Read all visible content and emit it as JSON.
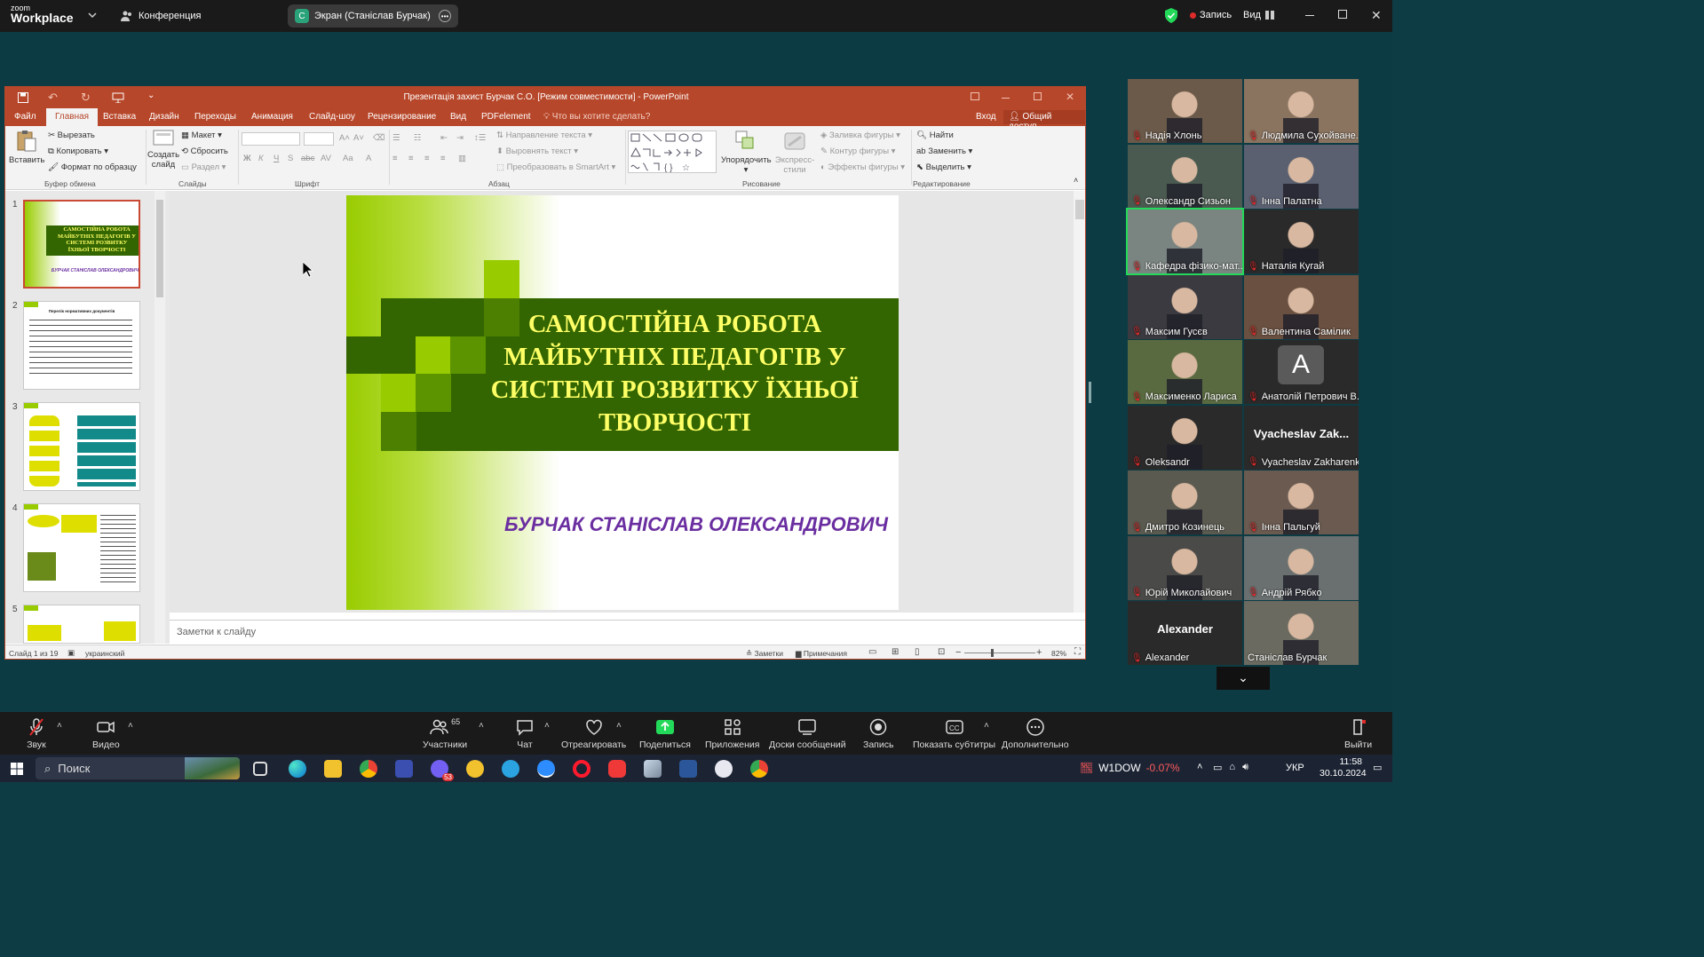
{
  "zoom": {
    "logo_top": "zoom",
    "logo_bottom": "Workplace",
    "meeting_label": "Конференция",
    "share_label": "Экран (Станіслав Бурчак)",
    "share_initial": "C",
    "record_label": "Запись",
    "view_label": "Вид"
  },
  "ppt": {
    "title": "Презентація захист Бурчак С.О. [Режим совместимости] - PowerPoint",
    "tabs": [
      "Файл",
      "Главная",
      "Вставка",
      "Дизайн",
      "Переходы",
      "Анимация",
      "Слайд-шоу",
      "Рецензирование",
      "Вид",
      "PDFelement"
    ],
    "tell_me": "Что вы хотите сделать?",
    "signin": "Вход",
    "share": "Общий доступ",
    "ribbon": {
      "paste": "Вставить",
      "cut": "Вырезать",
      "copy": "Копировать",
      "format_painter": "Формат по образцу",
      "clipboard": "Буфер обмена",
      "new_slide_1": "Создать",
      "new_slide_2": "слайд",
      "layout": "Макет",
      "reset": "Сбросить",
      "section": "Раздел",
      "slides": "Слайды",
      "font": "Шрифт",
      "text_direction": "Направление текста",
      "align_text": "Выровнять текст",
      "smartart": "Преобразовать в SmartArt",
      "paragraph": "Абзац",
      "arrange": "Упорядочить",
      "quick_styles_1": "Экспресс-",
      "quick_styles_2": "стили",
      "shape_fill": "Заливка фигуры",
      "shape_outline": "Контур фигуры",
      "shape_effects": "Эффекты фигуры",
      "drawing": "Рисование",
      "find": "Найти",
      "replace": "Заменить",
      "select": "Выделить",
      "editing": "Редактирование"
    },
    "thumb_numbers": [
      "1",
      "2",
      "3",
      "4",
      "5"
    ],
    "thumb1_title": "САМОСТІЙНА РОБОТА МАЙБУТНІХ ПЕДАГОГІВ У СИСТЕМІ РОЗВИТКУ ЇХНЬОЇ ТВОРЧОСТІ",
    "thumb1_author": "БУРЧАК СТАНІСЛАВ ОЛЕКСАНДРОВИЧ",
    "thumb2_title": "Перелік нормативних документів",
    "slide_title": "САМОСТІЙНА РОБОТА МАЙБУТНІХ ПЕДАГОГІВ У СИСТЕМІ РОЗВИТКУ ЇХНЬОЇ ТВОРЧОСТІ",
    "slide_author": "БУРЧАК СТАНІСЛАВ ОЛЕКСАНДРОВИЧ",
    "notes_placeholder": "Заметки к слайду",
    "status_slide": "Слайд 1 из 19",
    "status_lang": "украинский",
    "status_notes": "Заметки",
    "status_comments": "Примечания",
    "zoom_level": "82%"
  },
  "participants": [
    {
      "name": "Надія Хлонь",
      "bg": "#6b5a4a",
      "muted": true
    },
    {
      "name": "Людмила Сухойване...",
      "bg": "#8a7460",
      "muted": true
    },
    {
      "name": "Олександр Сизьон",
      "bg": "#4a5a50",
      "muted": true
    },
    {
      "name": "Інна Палатна",
      "bg": "#5a6070",
      "muted": true
    },
    {
      "name": "Кафедра фізико-мат...",
      "bg": "#7a8480",
      "muted": true,
      "active": true
    },
    {
      "name": "Наталія Кугай",
      "bg": "#2a2a2a",
      "muted": true
    },
    {
      "name": "Максим Гусєв",
      "bg": "#3a3a40",
      "muted": true
    },
    {
      "name": "Валентина Самілик",
      "bg": "#6a5040",
      "muted": true
    },
    {
      "name": "Максименко Лариса",
      "bg": "#5a6a40",
      "muted": true
    },
    {
      "name": "Анатолій Петрович В...",
      "bg": "#2a2a2a",
      "muted": true,
      "initial": "A"
    },
    {
      "name": "Oleksandr",
      "bg": "#2a2a2a",
      "muted": true
    },
    {
      "name": "Vyacheslav Zakharenko",
      "bg": "#2a2a2a",
      "muted": true,
      "label": "Vyacheslav  Zak..."
    },
    {
      "name": "Дмитро Козинець",
      "bg": "#5a5a50",
      "muted": true
    },
    {
      "name": "Інна Пальгуй",
      "bg": "#6a5a50",
      "muted": true
    },
    {
      "name": "Юрій Миколайович",
      "bg": "#4a4a48",
      "muted": true
    },
    {
      "name": "Андрій Рябко",
      "bg": "#6a7070",
      "muted": true
    },
    {
      "name": "Alexander",
      "bg": "#2a2a2a",
      "muted": true,
      "label": "Alexander"
    },
    {
      "name": "Станіслав Бурчак",
      "bg": "#6a6a60",
      "muted": false
    }
  ],
  "toolbar": {
    "audio": "Звук",
    "video": "Видео",
    "participants": "Участники",
    "participants_count": "65",
    "chat": "Чат",
    "react": "Отреагировать",
    "share": "Поделиться",
    "apps": "Приложения",
    "whiteboards": "Доски сообщений",
    "record": "Запись",
    "captions": "Показать субтитры",
    "more": "Дополнительно",
    "leave": "Выйти"
  },
  "taskbar": {
    "search": "Поиск",
    "stock_name": "W1DOW",
    "stock_change": "-0.07%",
    "lang": "УКР",
    "time": "11:58",
    "date": "30.10.2024",
    "badge": "53"
  },
  "colors": {
    "ppt_red": "#b7472a",
    "slide_green_dark": "#3a6b00",
    "slide_green_light": "#99cc00",
    "slide_title": "#ffff66",
    "slide_author": "#6a2ea0",
    "zoom_green": "#23d959",
    "negative": "#ff5a5a"
  }
}
